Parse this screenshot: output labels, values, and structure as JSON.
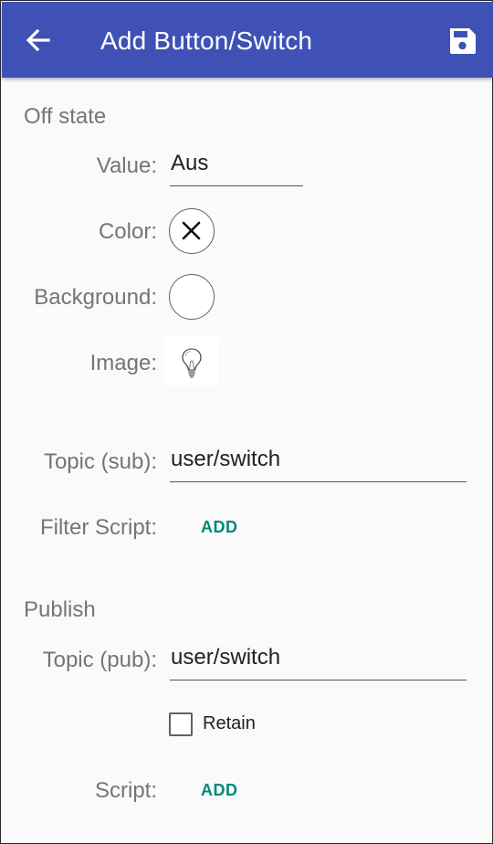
{
  "appbar": {
    "title": "Add Button/Switch",
    "back_icon": "arrow-left-icon",
    "save_icon": "floppy-disk-icon",
    "color": "#3f51b5"
  },
  "off_state": {
    "section_title": "Off state",
    "value_label": "Value:",
    "value": "Aus",
    "color_label": "Color:",
    "color_value": "none",
    "background_label": "Background:",
    "background_value": "#ffffff",
    "image_label": "Image:",
    "image_icon": "lightbulb-icon"
  },
  "subscribe": {
    "topic_label": "Topic (sub):",
    "topic_value": "user/switch",
    "filter_label": "Filter Script:",
    "filter_add": "ADD"
  },
  "publish": {
    "section_title": "Publish",
    "topic_label": "Topic (pub):",
    "topic_value": "user/switch",
    "retain_label": "Retain",
    "retain_checked": false,
    "script_label": "Script:",
    "script_add": "ADD"
  },
  "accent_color": "#00897b"
}
